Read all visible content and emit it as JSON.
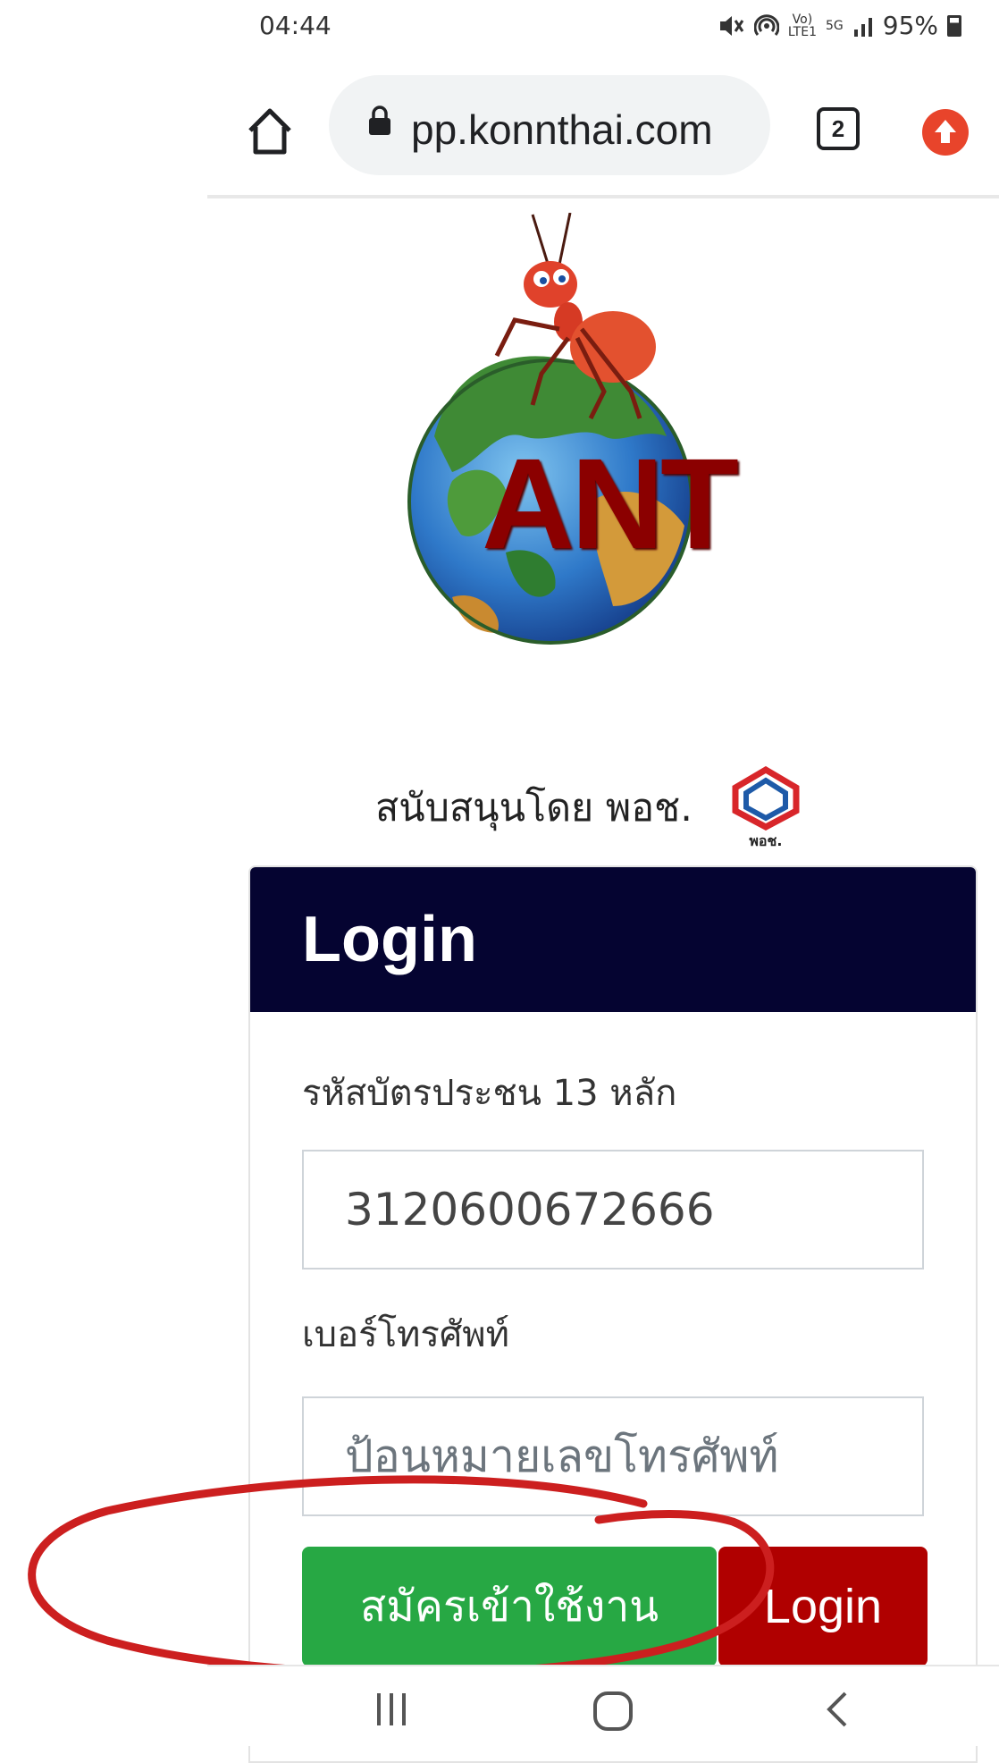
{
  "status_bar": {
    "time": "04:44",
    "volte_top": "Vo)",
    "volte_bottom": "LTE1",
    "network": "5G",
    "battery": "95%"
  },
  "browser": {
    "url": "pp.konnthai.com",
    "tab_count": "2",
    "icons": [
      "home-icon",
      "lock-icon",
      "tabs-icon",
      "update-icon"
    ]
  },
  "logo": {
    "label": "ANT"
  },
  "support": {
    "text": "สนับสนุนโดย พอช.",
    "logo_label": "พอช."
  },
  "login_card": {
    "title": "Login",
    "id_label": "รหัสบัตรประชน 13 หลัก",
    "id_value": "3120600672666",
    "phone_label": "เบอร์โทรศัพท์",
    "phone_placeholder": "ป้อนหมายเลขโทรศัพท์",
    "register_button": "สมัครเข้าใช้งาน",
    "login_button": "Login",
    "colors": {
      "header": "#050431",
      "register": "#27a844",
      "login": "#b00000"
    }
  },
  "annotation": {
    "color": "#cc1f1f"
  },
  "nav": {
    "icons": [
      "recent-apps-icon",
      "home-nav-icon",
      "back-icon"
    ]
  }
}
